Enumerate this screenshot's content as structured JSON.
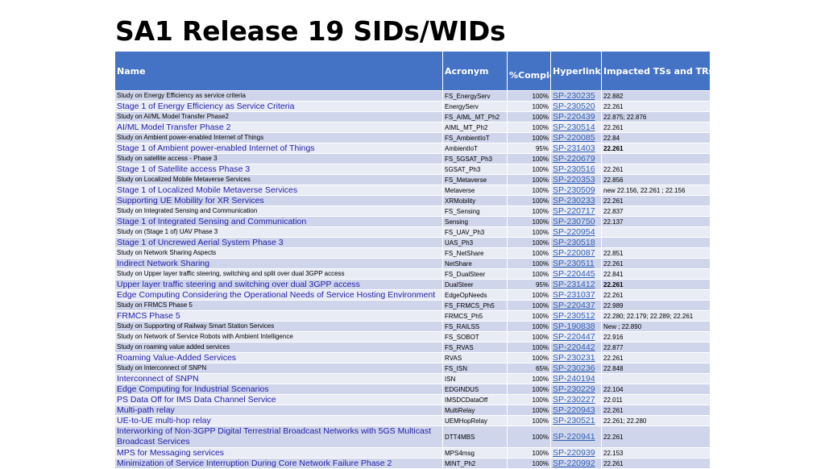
{
  "title": "SA1 Release 19 SIDs/WIDs",
  "columns": {
    "name": "Name",
    "acronym": "Acronym",
    "complete": "%Complete",
    "hyperlink": "Hyperlink",
    "impacted": "Impacted TSs and TRs"
  },
  "rows": [
    {
      "name": "Study on Energy Efficiency as service criteria",
      "acronym": "FS_EnergyServ",
      "complete": "100%",
      "link": "SP-230235",
      "impacted": "22.882",
      "kind": "study"
    },
    {
      "name": "Stage 1 of Energy Efficiency as Service Criteria",
      "acronym": "EnergyServ",
      "complete": "100%",
      "link": "SP-230520",
      "impacted": "22.261",
      "kind": "wid"
    },
    {
      "name": "Study on AI/ML Model Transfer Phase2",
      "acronym": "FS_AIML_MT_Ph2",
      "complete": "100%",
      "link": "SP-220439",
      "impacted": "22.875; 22.876",
      "kind": "study"
    },
    {
      "name": "AI/ML Model Transfer Phase 2",
      "acronym": "AIML_MT_Ph2",
      "complete": "100%",
      "link": "SP-230514",
      "impacted": "22.261",
      "kind": "wid"
    },
    {
      "name": "Study on Ambient power-enabled Internet of Things",
      "acronym": "FS_AmbientIoT",
      "complete": "100%",
      "link": "SP-220085",
      "impacted": "22.84",
      "kind": "study"
    },
    {
      "name": "Stage 1 of Ambient power-enabled Internet of Things",
      "acronym": "AmbientIoT",
      "complete": "95%",
      "link": "SP-231403",
      "impacted": "22.261",
      "kind": "wid",
      "bold": true
    },
    {
      "name": "Study on satellite access - Phase 3",
      "acronym": "FS_5GSAT_Ph3",
      "complete": "100%",
      "link": "SP-220679",
      "impacted": "",
      "kind": "study"
    },
    {
      "name": "Stage 1 of Satellite access Phase 3",
      "acronym": "5GSAT_Ph3",
      "complete": "100%",
      "link": "SP-230516",
      "impacted": "22.261",
      "kind": "wid"
    },
    {
      "name": "Study on Localized Mobile Metaverse Services",
      "acronym": "FS_Metaverse",
      "complete": "100%",
      "link": "SP-220353",
      "impacted": "22.856",
      "kind": "study"
    },
    {
      "name": "Stage 1 of Localized Mobile Metaverse Services",
      "acronym": "Metaverse",
      "complete": "100%",
      "link": "SP-230509",
      "impacted": "new 22.156, 22.261 ; 22.156",
      "kind": "wid"
    },
    {
      "name": "Supporting UE Mobility for XR Services",
      "acronym": "XRMobility",
      "complete": "100%",
      "link": "SP-230233",
      "impacted": "22.261",
      "kind": "wid"
    },
    {
      "name": "Study on Integrated Sensing and Communication",
      "acronym": "FS_Sensing",
      "complete": "100%",
      "link": "SP-220717",
      "impacted": "22.837",
      "kind": "study"
    },
    {
      "name": "Stage 1 of Integrated Sensing and Communication",
      "acronym": "Sensing",
      "complete": "100%",
      "link": "SP-230750",
      "impacted": "22.137",
      "kind": "wid"
    },
    {
      "name": "Study on (Stage 1 of) UAV Phase 3",
      "acronym": "FS_UAV_Ph3",
      "complete": "100%",
      "link": "SP-220954",
      "impacted": "",
      "kind": "study"
    },
    {
      "name": "Stage 1 of Uncrewed Aerial System Phase 3",
      "acronym": "UAS_Ph3",
      "complete": "100%",
      "link": "SP-230518",
      "impacted": "",
      "kind": "wid"
    },
    {
      "name": "Study on Network Sharing Aspects",
      "acronym": "FS_NetShare",
      "complete": "100%",
      "link": "SP-220087",
      "impacted": "22.851",
      "kind": "study"
    },
    {
      "name": "Indirect Network Sharing",
      "acronym": "NetShare",
      "complete": "100%",
      "link": "SP-230511",
      "impacted": "22.261",
      "kind": "wid"
    },
    {
      "name": "Study on Upper layer traffic steering, switching and split over dual 3GPP access",
      "acronym": "FS_DualSteer",
      "complete": "100%",
      "link": "SP-220445",
      "impacted": "22.841",
      "kind": "study"
    },
    {
      "name": "Upper layer traffic steering and switching over dual 3GPP access",
      "acronym": "DualSteer",
      "complete": "95%",
      "link": "SP-231412",
      "impacted": "22.261",
      "kind": "wid",
      "bold": true
    },
    {
      "name": "Edge Computing Considering the Operational Needs of Service Hosting Environment",
      "acronym": "EdgeOpNeeds",
      "complete": "100%",
      "link": "SP-231037",
      "impacted": "22.261",
      "kind": "wid"
    },
    {
      "name": "Study on FRMCS Phase 5",
      "acronym": "FS_FRMCS_Ph5",
      "complete": "100%",
      "link": "SP-220437",
      "impacted": "22.989",
      "kind": "study"
    },
    {
      "name": "FRMCS Phase 5",
      "acronym": "FRMCS_Ph5",
      "complete": "100%",
      "link": "SP-230512",
      "impacted": "22.280; 22.179; 22.289; 22.261",
      "kind": "wid"
    },
    {
      "name": "Study on Supporting of Railway Smart Station Services",
      "acronym": "FS_RAILSS",
      "complete": "100%",
      "link": "SP-190838",
      "impacted": "New ; 22.890",
      "kind": "study"
    },
    {
      "name": "Study on Network of Service Robots with Ambient Intelligence",
      "acronym": "FS_SOBOT",
      "complete": "100%",
      "link": "SP-220447",
      "impacted": "22.916",
      "kind": "study"
    },
    {
      "name": "Study on roaming value added services",
      "acronym": "FS_RVAS",
      "complete": "100%",
      "link": "SP-220442",
      "impacted": "22.877",
      "kind": "study"
    },
    {
      "name": "Roaming Value-Added Services",
      "acronym": "RVAS",
      "complete": "100%",
      "link": "SP-230231",
      "impacted": "22.261",
      "kind": "wid"
    },
    {
      "name": "Study on Interconnect of SNPN",
      "acronym": "FS_ISN",
      "complete": "65%",
      "link": "SP-230236",
      "impacted": "22.848",
      "kind": "study"
    },
    {
      "name": "Interconnect of SNPN",
      "acronym": "ISN",
      "complete": "100%",
      "link": "SP-240194",
      "impacted": "",
      "kind": "wid"
    },
    {
      "name": "Edge Computing for Industrial Scenarios",
      "acronym": "EDGINDUS",
      "complete": "100%",
      "link": "SP-230229",
      "impacted": "22.104",
      "kind": "wid"
    },
    {
      "name": "PS Data Off for IMS Data Channel Service",
      "acronym": "IMSDCDataOff",
      "complete": "100%",
      "link": "SP-230227",
      "impacted": "22.011",
      "kind": "wid"
    },
    {
      "name": "Multi-path relay",
      "acronym": "MultiRelay",
      "complete": "100%",
      "link": "SP-220943",
      "impacted": "22.261",
      "kind": "wid"
    },
    {
      "name": "UE-to-UE multi-hop relay",
      "acronym": "UEMHopRelay",
      "complete": "100%",
      "link": "SP-230521",
      "impacted": "22.261; 22.280",
      "kind": "wid"
    },
    {
      "name": "Interworking of Non-3GPP Digital Terrestrial Broadcast Networks with 5GS Multicast Broadcast Services",
      "acronym": "DTT4MBS",
      "complete": "100%",
      "link": "SP-220941",
      "impacted": "22.261",
      "kind": "wid",
      "tall": true
    },
    {
      "name": "MPS for Messaging services",
      "acronym": "MPS4msg",
      "complete": "100%",
      "link": "SP-220939",
      "impacted": "22.153",
      "kind": "wid"
    },
    {
      "name": "Minimization of Service Interruption During Core Network Failure Phase 2",
      "acronym": "MINT_Ph2",
      "complete": "100%",
      "link": "SP-220992",
      "impacted": "22.261",
      "kind": "wid"
    }
  ]
}
